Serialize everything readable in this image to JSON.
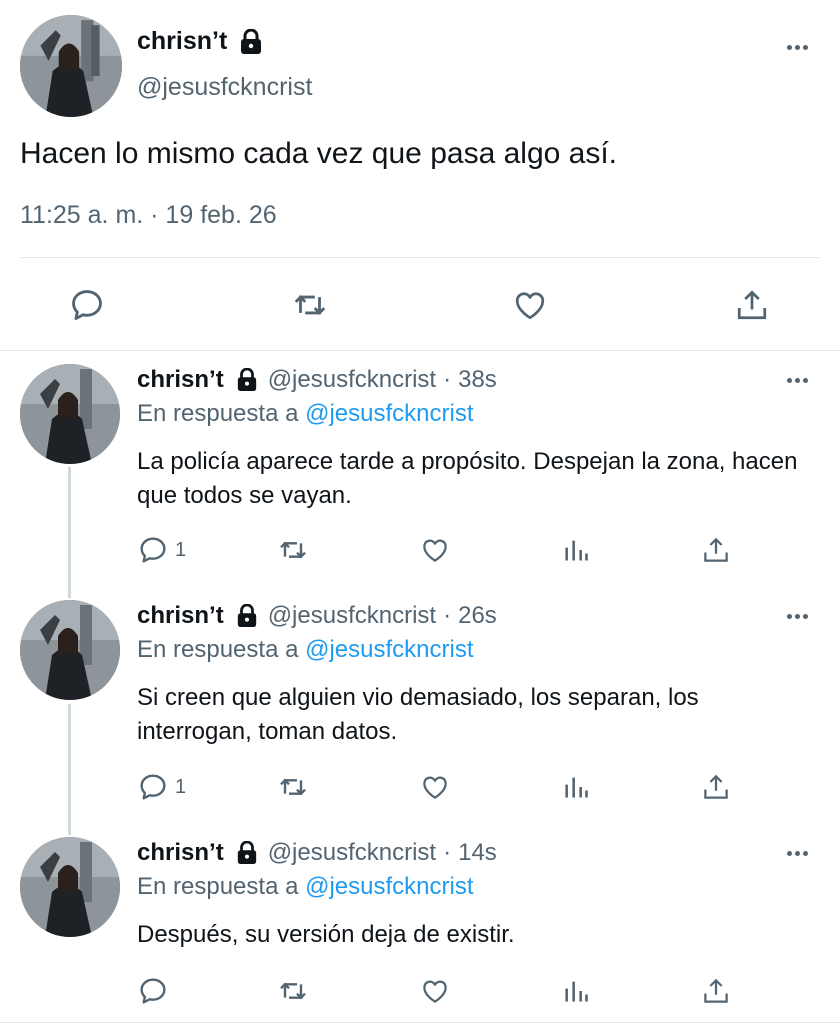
{
  "main_tweet": {
    "display_name": "chrisn’t",
    "handle": "@jesusfckncrist",
    "text": "Hacen lo mismo cada vez que pasa algo así.",
    "timestamp": "11:25 a. m. · 19 feb. 26",
    "actions": [
      "reply-icon",
      "retweet-icon",
      "like-icon",
      "share-icon"
    ]
  },
  "replies": [
    {
      "display_name": "chrisn’t",
      "handle": "@jesusfckncrist",
      "dot": "·",
      "time": "38s",
      "in_reply_prefix": "En respuesta a",
      "in_reply_handle": "@jesusfckncrist",
      "text": "La policía aparece tarde a propósito. Despejan la zona, hacen que todos se vayan.",
      "reply_count": "1"
    },
    {
      "display_name": "chrisn’t",
      "handle": "@jesusfckncrist",
      "dot": "·",
      "time": "26s",
      "in_reply_prefix": "En respuesta a",
      "in_reply_handle": "@jesusfckncrist",
      "text": "Si creen que alguien vio demasiado, los separan, los interrogan, toman datos.",
      "reply_count": "1"
    },
    {
      "display_name": "chrisn’t",
      "handle": "@jesusfckncrist",
      "dot": "·",
      "time": "14s",
      "in_reply_prefix": "En respuesta a",
      "in_reply_handle": "@jesusfckncrist",
      "text": "Después, su versión deja de existir.",
      "reply_count": ""
    }
  ],
  "colors": {
    "text": "#0f1419",
    "secondary": "#536471",
    "link": "#1d9bf0",
    "divider": "#e1e5e8",
    "thread_line": "#cfd9de"
  }
}
